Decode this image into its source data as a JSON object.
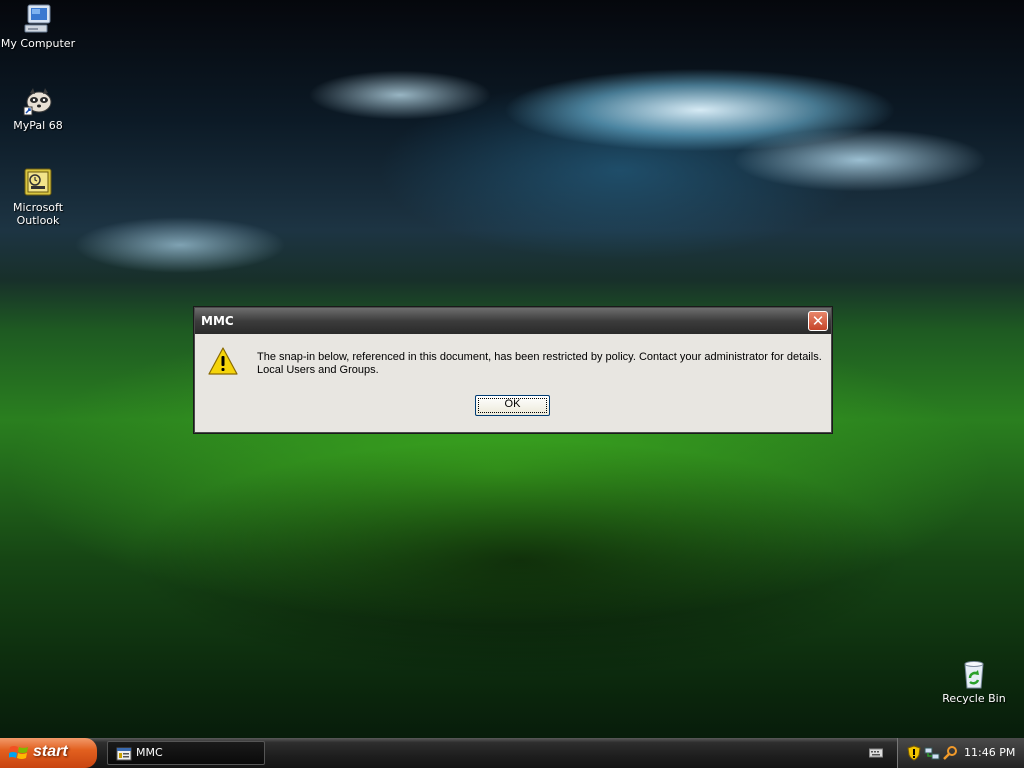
{
  "desktop": {
    "icons": [
      {
        "label": "My Computer"
      },
      {
        "label": "MyPal 68"
      },
      {
        "label": "Microsoft Outlook"
      },
      {
        "label": "Recycle Bin"
      }
    ]
  },
  "dialog": {
    "title": "MMC",
    "message_line1": "The snap-in below, referenced in this document, has been restricted by policy. Contact your administrator for details.",
    "message_line2": "Local Users and Groups.",
    "ok_label": "OK",
    "close_label": "✕"
  },
  "taskbar": {
    "start_label": "start",
    "tasks": [
      {
        "label": "MMC"
      }
    ],
    "clock": "11:46 PM"
  },
  "colors": {
    "dialog_bg": "#ece9d8",
    "titlebar": "#3c3c3c",
    "start_orange": "#e2601f",
    "close_red": "#c6452a"
  }
}
